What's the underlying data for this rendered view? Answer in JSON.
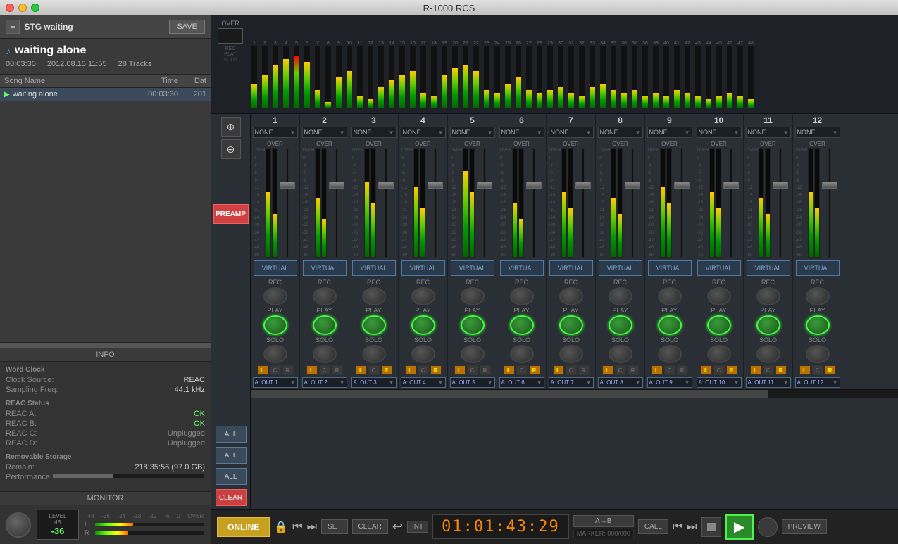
{
  "window": {
    "title": "R-1000 RCS"
  },
  "stg": {
    "title": "STG waiting",
    "save_label": "SAVE",
    "menu_icon": "≡"
  },
  "song": {
    "name": "waiting alone",
    "duration": "00:03:30",
    "date": "2012.08.15 11:55",
    "tracks": "28 Tracks"
  },
  "song_list": {
    "headers": [
      "Song Name",
      "Time",
      "Dat"
    ],
    "rows": [
      {
        "name": "waiting alone",
        "time": "00:03:30",
        "dat": "201"
      }
    ]
  },
  "info": {
    "section_label": "INFO",
    "word_clock": {
      "label": "Word Clock",
      "clock_source_label": "Clock Source:",
      "clock_source_value": "REAC",
      "sampling_freq_label": "Sampling Freq:",
      "sampling_freq_value": "44.1 kHz"
    },
    "reac_status": {
      "label": "REAC Status",
      "reac_a_label": "REAC A:",
      "reac_a_value": "OK",
      "reac_b_label": "REAC B:",
      "reac_b_value": "OK",
      "reac_c_label": "REAC C:",
      "reac_c_value": "Unplugged",
      "reac_d_label": "REAC D:",
      "reac_d_value": "Unplugged"
    },
    "removable_storage": {
      "label": "Removable Storage",
      "remain_label": "Remain:",
      "remain_value": "218:35:56 (97.0 GB)",
      "performance_label": "Performance:"
    }
  },
  "monitor": {
    "section_label": "MONITOR",
    "level_label": "LEVEL\ndB",
    "level_value": "-36",
    "meter_scale": [
      "-48",
      "-36",
      "-24",
      "-18",
      "-12",
      "-6",
      "0",
      "OVER"
    ],
    "meter_l_label": "L",
    "meter_r_label": "R",
    "meter_l_fill": "35%",
    "meter_r_fill": "30%"
  },
  "channels": [
    {
      "num": "1",
      "assign": "NONE"
    },
    {
      "num": "2",
      "assign": "NONE"
    },
    {
      "num": "3",
      "assign": "NONE"
    },
    {
      "num": "4",
      "assign": "NONE"
    },
    {
      "num": "5",
      "assign": "NONE"
    },
    {
      "num": "6",
      "assign": "NONE"
    },
    {
      "num": "7",
      "assign": "NONE"
    },
    {
      "num": "8",
      "assign": "NONE"
    },
    {
      "num": "9",
      "assign": "NONE"
    },
    {
      "num": "10",
      "assign": "NONE"
    },
    {
      "num": "11",
      "assign": "NONE"
    },
    {
      "num": "12",
      "assign": "NONE"
    }
  ],
  "channel_buttons": {
    "virtual_label": "VIRTUAL",
    "rec_label": "REC",
    "play_label": "PLAY",
    "solo_label": "SOLO",
    "all_label": "ALL",
    "clear_label": "CLEAR"
  },
  "outputs": [
    "A: OUT 1",
    "A: OUT 2",
    "A: OUT 3",
    "A: OUT 4",
    "A: OUT 5",
    "A: OUT 6",
    "A: OUT 7",
    "A: OUT 8",
    "A: OUT 9",
    "A: OUT 10",
    "A: OUT 11",
    "A: OUT 12"
  ],
  "lcr_data": [
    {
      "l": true,
      "c": false,
      "r": false
    },
    {
      "l": true,
      "c": false,
      "r": false
    },
    {
      "l": true,
      "c": false,
      "r": true
    },
    {
      "l": true,
      "c": false,
      "r": true
    },
    {
      "l": true,
      "c": false,
      "r": false
    },
    {
      "l": true,
      "c": false,
      "r": true
    },
    {
      "l": true,
      "c": false,
      "r": false
    },
    {
      "l": true,
      "c": false,
      "r": false
    },
    {
      "l": true,
      "c": false,
      "r": false
    },
    {
      "l": true,
      "c": false,
      "r": true
    },
    {
      "l": true,
      "c": false,
      "r": true
    },
    {
      "l": true,
      "c": false,
      "r": true
    }
  ],
  "meter_heights": [
    40,
    55,
    70,
    80,
    85,
    75,
    30,
    10,
    50,
    60,
    20,
    15,
    35,
    45,
    55,
    60,
    25,
    20,
    55,
    65,
    70,
    60,
    30,
    25,
    40,
    50,
    30,
    25,
    30,
    35,
    25,
    20,
    35,
    40,
    30,
    25,
    30,
    20,
    25,
    20,
    30,
    25,
    20,
    15,
    20,
    25,
    20,
    15
  ],
  "transport": {
    "online_label": "ONLINE",
    "set_label": "SET",
    "clear_label": "CLEAR",
    "int_label": "INT",
    "timecode": "01:01:43:29",
    "marker_label": "MARKER: 000/000",
    "ab_label": "A→B",
    "call_label": "CALL",
    "preview_label": "PREVIEW"
  },
  "fader_scales": [
    "OVER",
    "0",
    "-3",
    "-6",
    "-9",
    "-12",
    "-15",
    "-18",
    "-21",
    "-24",
    "-30",
    "-36",
    "-42",
    "-48",
    "-60"
  ],
  "preamp_label": "PREAMP"
}
